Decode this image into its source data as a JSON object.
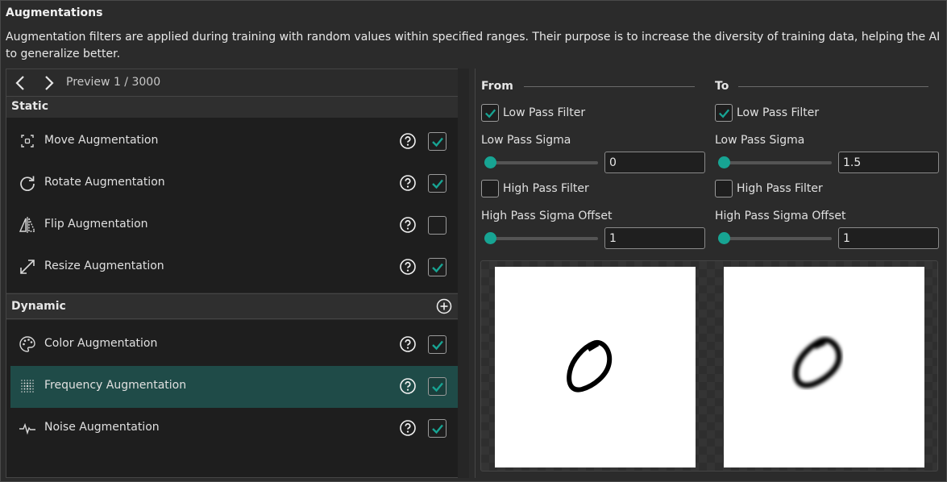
{
  "header": {
    "title": "Augmentations",
    "description": "Augmentation filters are applied during training with random values within specified ranges. Their purpose is to increase the diversity of training data, helping the AI to generalize better."
  },
  "nav": {
    "prev_icon": "chevron-left-icon",
    "next_icon": "chevron-right-icon",
    "preview_label": "Preview 1 / 3000"
  },
  "static_section": {
    "label": "Static",
    "items": [
      {
        "label": "Move Augmentation",
        "icon": "move-icon",
        "checked": true
      },
      {
        "label": "Rotate Augmentation",
        "icon": "rotate-icon",
        "checked": true
      },
      {
        "label": "Flip Augmentation",
        "icon": "flip-icon",
        "checked": false
      },
      {
        "label": "Resize Augmentation",
        "icon": "resize-icon",
        "checked": true
      }
    ]
  },
  "dynamic_section": {
    "label": "Dynamic",
    "add_icon": "add-circle-icon",
    "items": [
      {
        "label": "Color Augmentation",
        "icon": "palette-icon",
        "checked": true,
        "selected": false
      },
      {
        "label": "Frequency Augmentation",
        "icon": "frequency-icon",
        "checked": true,
        "selected": true
      },
      {
        "label": "Noise Augmentation",
        "icon": "noise-icon",
        "checked": true,
        "selected": false
      }
    ]
  },
  "from": {
    "heading": "From",
    "low_pass_filter_label": "Low Pass Filter",
    "low_pass_filter_checked": true,
    "low_pass_sigma_label": "Low Pass Sigma",
    "low_pass_sigma_value": "0",
    "high_pass_filter_label": "High Pass Filter",
    "high_pass_filter_checked": false,
    "high_pass_offset_label": "High Pass Sigma Offset",
    "high_pass_offset_value": "1"
  },
  "to": {
    "heading": "To",
    "low_pass_filter_label": "Low Pass Filter",
    "low_pass_filter_checked": true,
    "low_pass_sigma_label": "Low Pass Sigma",
    "low_pass_sigma_value": "1.5",
    "high_pass_filter_label": "High Pass Filter",
    "high_pass_filter_checked": false,
    "high_pass_offset_label": "High Pass Sigma Offset",
    "high_pass_offset_value": "1"
  },
  "colors": {
    "accent": "#17a493",
    "selected_row": "#1f4b48",
    "panel_bg": "#1e1e1e",
    "window_bg": "#2b2b2b"
  }
}
